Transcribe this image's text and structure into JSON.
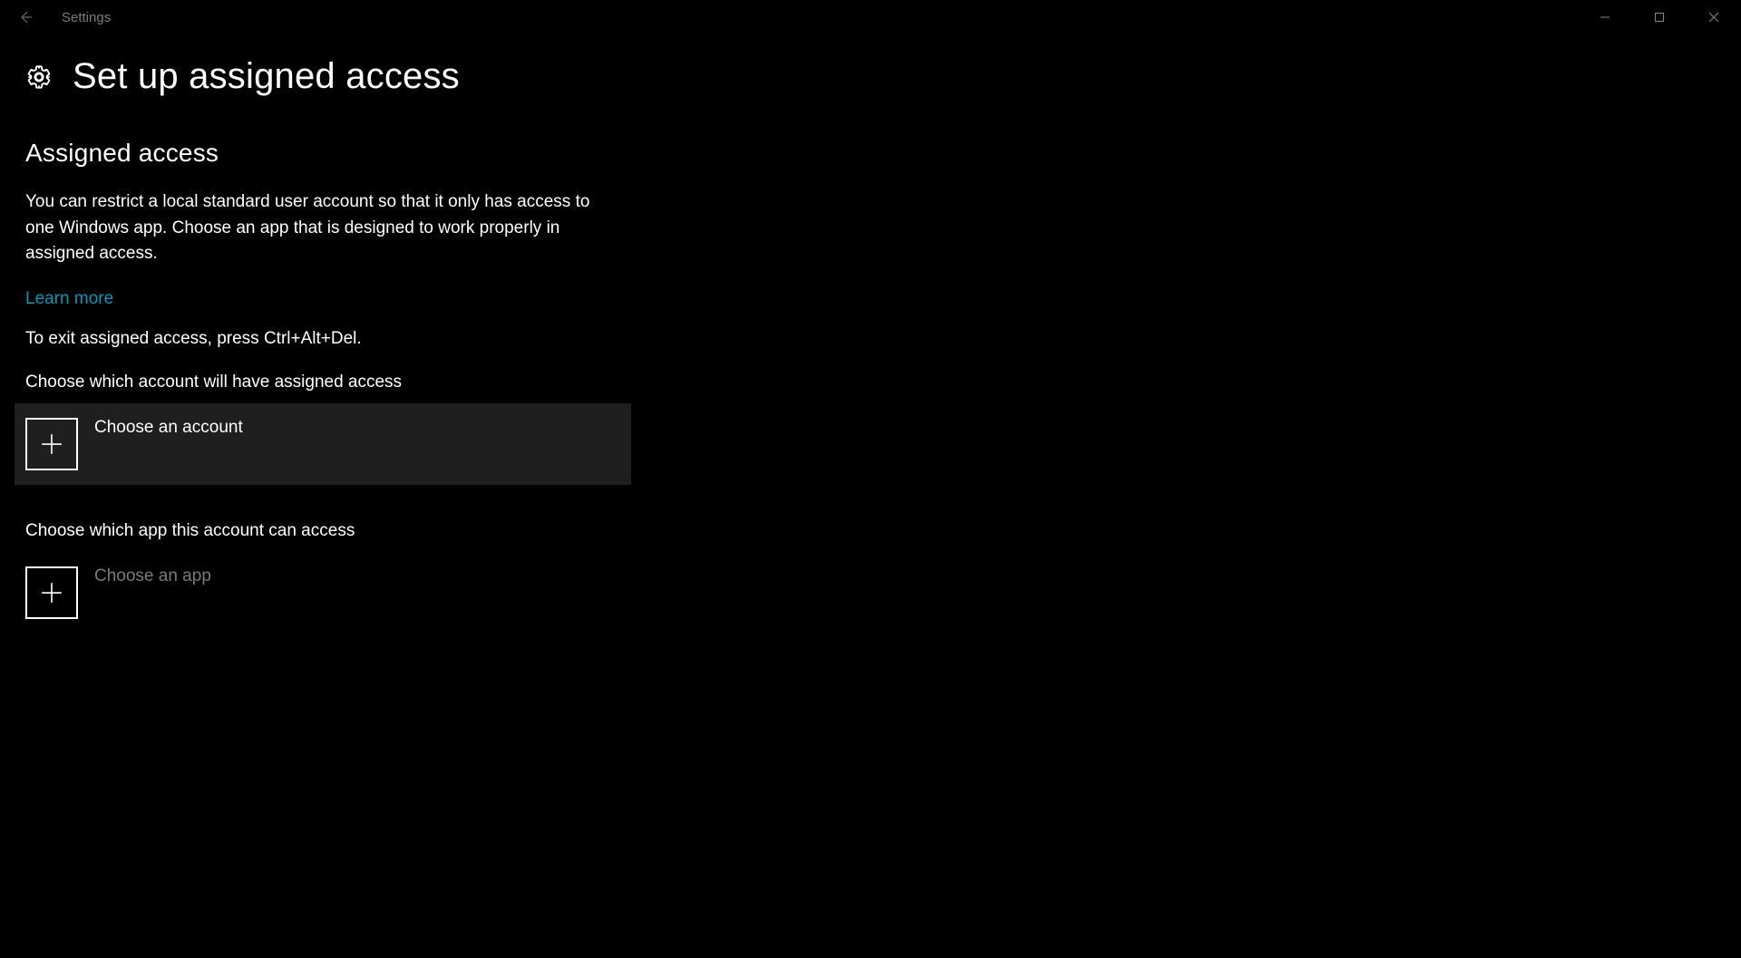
{
  "titlebar": {
    "app_title": "Settings"
  },
  "page": {
    "title": "Set up assigned access"
  },
  "section": {
    "heading": "Assigned access",
    "description": "You can restrict a local standard user account so that it only has access to one Windows app. Choose an app that is designed to work properly in assigned access.",
    "learn_more": "Learn more",
    "exit_note": "To exit assigned access, press Ctrl+Alt+Del."
  },
  "account_picker": {
    "prompt": "Choose which account will have assigned access",
    "label": "Choose an account"
  },
  "app_picker": {
    "prompt": "Choose which app this account can access",
    "label": "Choose an app"
  }
}
